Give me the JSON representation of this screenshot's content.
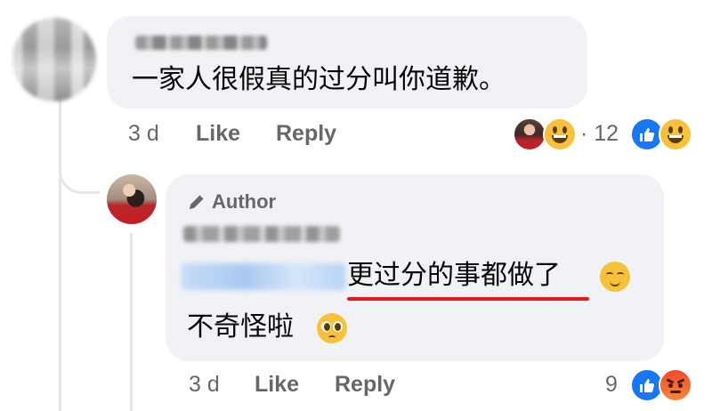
{
  "comment": {
    "text": "一家人很假真的过分叫你道歉。",
    "time": "3 d",
    "like_label": "Like",
    "reply_label": "Reply",
    "reaction_separator": "·",
    "reaction_count": "12",
    "reactions": [
      "like-icon",
      "grin-emoji-icon"
    ]
  },
  "reply": {
    "author_badge": "Author",
    "text_line1": "更过分的事都做了",
    "text_line2": "不奇怪啦",
    "time": "3 d",
    "like_label": "Like",
    "reply_label": "Reply",
    "reaction_count": "9",
    "reactions": [
      "like-icon",
      "angry-emoji-icon"
    ]
  },
  "colors": {
    "bubble": "#f0f2f5",
    "meta_text": "#65676b",
    "like_blue": "#1877f2",
    "highlight_underline": "#e5191d"
  }
}
